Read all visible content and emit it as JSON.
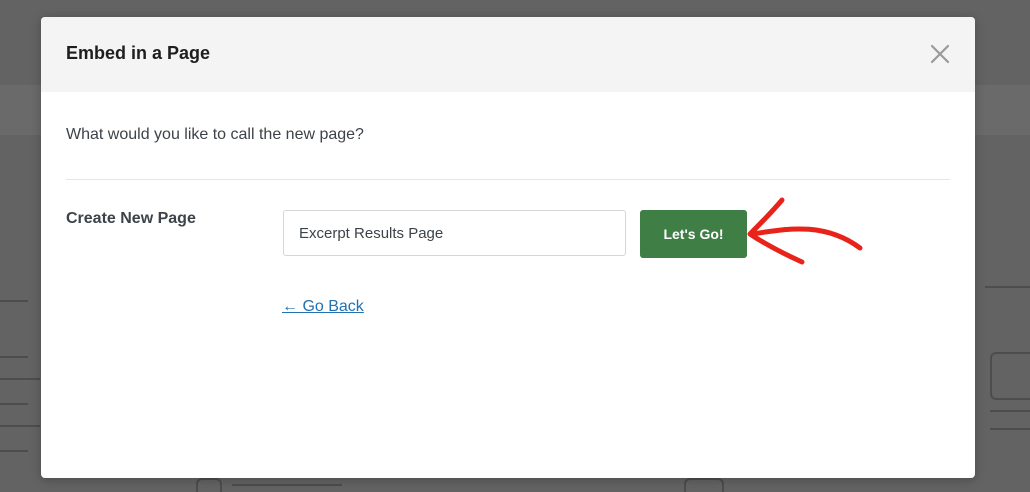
{
  "modal": {
    "title": "Embed in a Page",
    "question": "What would you like to call the new page?",
    "field_label": "Create New Page",
    "input_value": "Excerpt Results Page",
    "submit_label": "Let's Go!",
    "back_link": "← Go Back",
    "close_icon": "close-icon"
  },
  "colors": {
    "primary_button": "#3f7f45",
    "link": "#2271b1",
    "annotation_arrow": "#e8231a",
    "header_bg": "#f4f4f4"
  }
}
